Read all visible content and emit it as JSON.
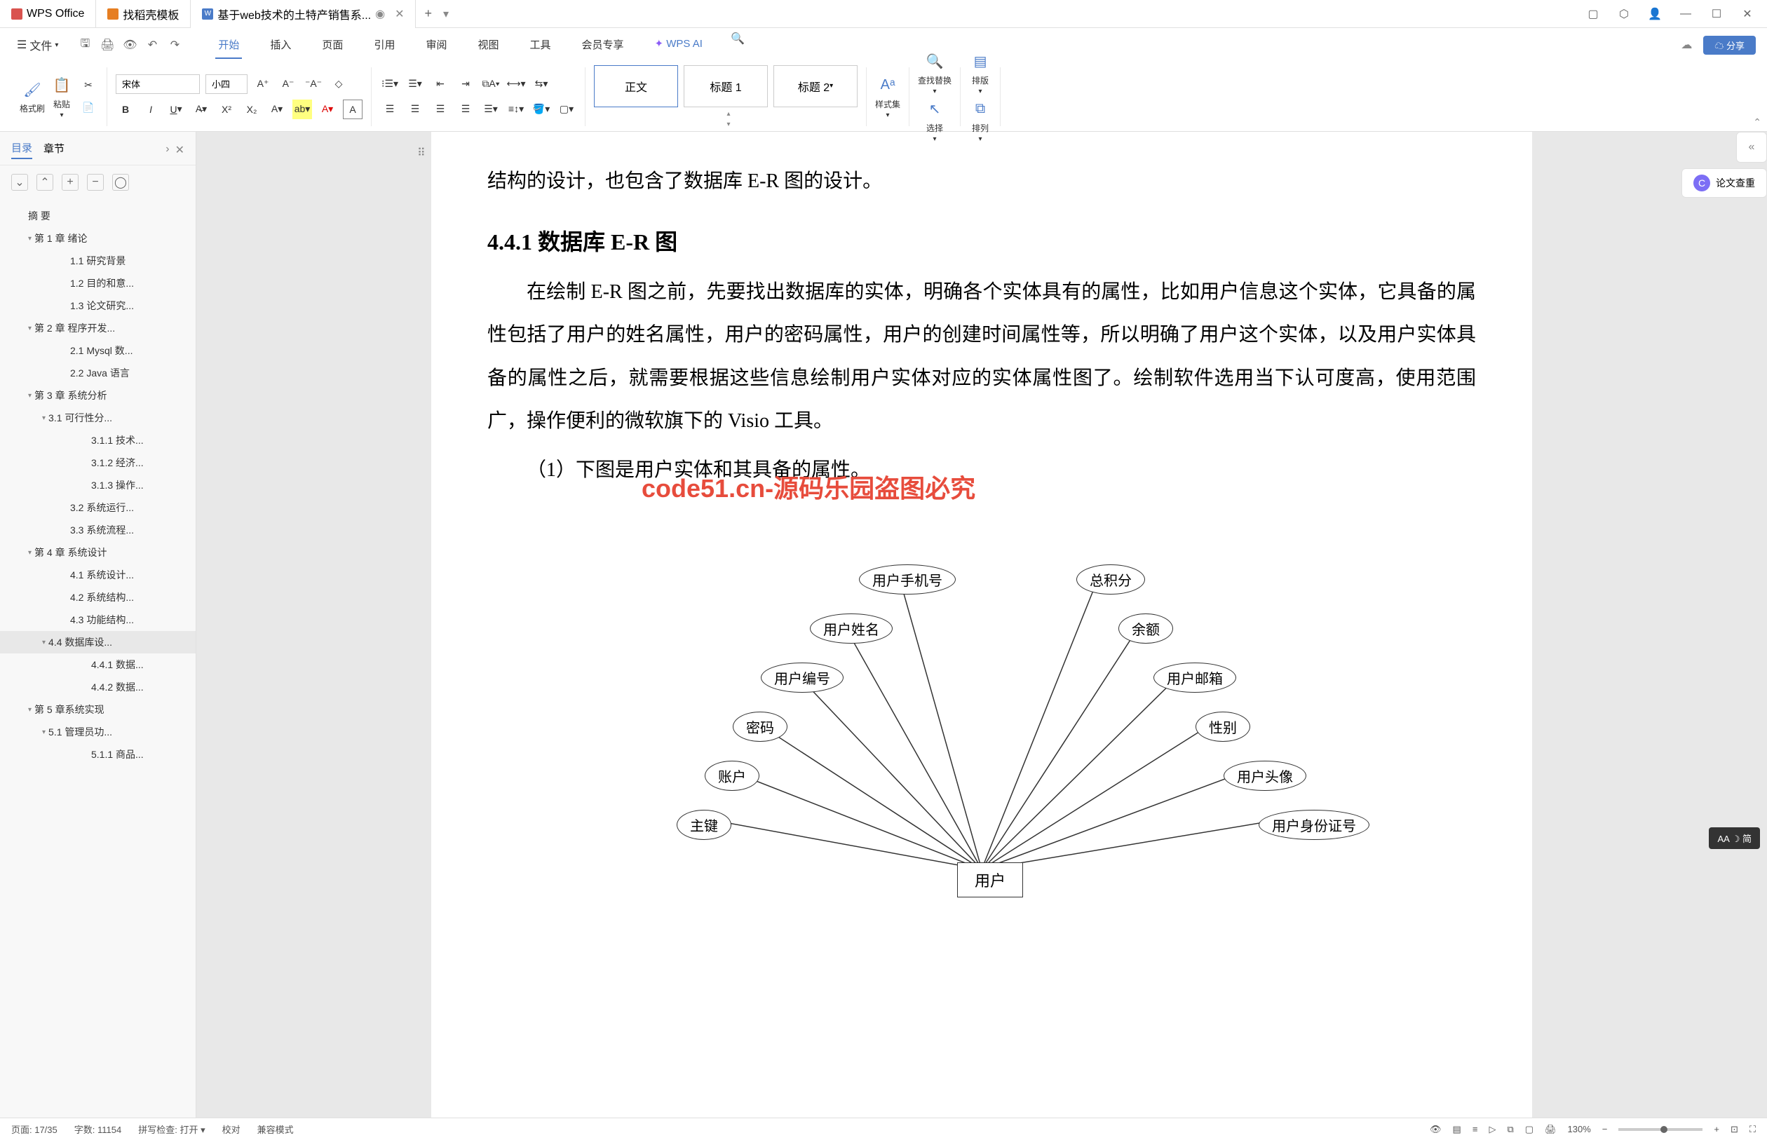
{
  "titlebar": {
    "tabs": [
      {
        "label": "WPS Office",
        "icon": "wps"
      },
      {
        "label": "找稻壳模板",
        "icon": "dk"
      },
      {
        "label": "基于web技术的土特产销售系...",
        "icon": "doc",
        "active": true
      }
    ]
  },
  "menubar": {
    "file": "文件",
    "tabs": [
      "开始",
      "插入",
      "页面",
      "引用",
      "审阅",
      "视图",
      "工具",
      "会员专享",
      "WPS AI"
    ],
    "active_tab": "开始",
    "share": "分享"
  },
  "ribbon": {
    "format_painter": "格式刷",
    "paste": "粘贴",
    "font_name": "宋体",
    "font_size": "小四",
    "styles": {
      "normal": "正文",
      "heading1": "标题 1",
      "heading2": "标题 2"
    },
    "style_set": "样式集",
    "find_replace": "查找替换",
    "select": "选择",
    "arrange": "排版",
    "sort": "排列"
  },
  "sidebar": {
    "tabs": {
      "outline": "目录",
      "chapters": "章节"
    },
    "toc": [
      {
        "label": "摘  要",
        "level": 0
      },
      {
        "label": "第 1 章  绪论",
        "level": 1,
        "expand": true
      },
      {
        "label": "1.1  研究背景",
        "level": 3
      },
      {
        "label": "1.2 目的和意...",
        "level": 3
      },
      {
        "label": "1.3  论文研究...",
        "level": 3
      },
      {
        "label": "第 2 章  程序开发...",
        "level": 1,
        "expand": true
      },
      {
        "label": "2.1 Mysql 数...",
        "level": 3
      },
      {
        "label": "2.2 Java 语言",
        "level": 3
      },
      {
        "label": "第 3 章  系统分析",
        "level": 1,
        "expand": true
      },
      {
        "label": "3.1  可行性分...",
        "level": 2,
        "expand": true
      },
      {
        "label": "3.1.1  技术...",
        "level": 4
      },
      {
        "label": "3.1.2  经济...",
        "level": 4
      },
      {
        "label": "3.1.3  操作...",
        "level": 4
      },
      {
        "label": "3.2  系统运行...",
        "level": 3
      },
      {
        "label": "3.3  系统流程...",
        "level": 3
      },
      {
        "label": "第 4 章  系统设计",
        "level": 1,
        "expand": true
      },
      {
        "label": "4.1  系统设计...",
        "level": 3
      },
      {
        "label": "4.2  系统结构...",
        "level": 3
      },
      {
        "label": "4.3 功能结构...",
        "level": 3
      },
      {
        "label": "4.4 数据库设...",
        "level": 2,
        "expand": true,
        "active": true
      },
      {
        "label": "4.4.1  数据...",
        "level": 4
      },
      {
        "label": "4.4.2  数据...",
        "level": 4
      },
      {
        "label": "第 5 章系统实现",
        "level": 1,
        "expand": true
      },
      {
        "label": "5.1  管理员功...",
        "level": 2,
        "expand": true
      },
      {
        "label": "5.1.1  商品...",
        "level": 4
      }
    ]
  },
  "document": {
    "line1": "结构的设计，也包含了数据库 E-R 图的设计。",
    "heading": "4.4.1  数据库 E-R 图",
    "para1": "在绘制 E-R 图之前，先要找出数据库的实体，明确各个实体具有的属性，比如用户信息这个实体，它具备的属性包括了用户的姓名属性，用户的密码属性，用户的创建时间属性等，所以明确了用户这个实体，以及用户实体具备的属性之后，就需要根据这些信息绘制用户实体对应的实体属性图了。绘制软件选用当下认可度高，使用范围广，操作便利的微软旗下的 Visio 工具。",
    "para2": "（1）下图是用户实体和其具备的属性。",
    "watermark_red": "code51.cn-源码乐园盗图必究",
    "er_attrs": [
      "用户手机号",
      "总积分",
      "用户姓名",
      "余额",
      "用户编号",
      "用户邮箱",
      "密码",
      "性别",
      "账户",
      "用户头像",
      "主键",
      "用户身份证号"
    ],
    "er_entity": "用户"
  },
  "right_panel": {
    "paper_check": "论文查重",
    "lang_toggle": "AA ☽ 简"
  },
  "statusbar": {
    "page": "页面: 17/35",
    "words": "字数: 11154",
    "spell": "拼写检查: 打开",
    "proof": "校对",
    "compat": "兼容模式",
    "zoom": "130%"
  },
  "watermarks": [
    "code51.cn"
  ]
}
